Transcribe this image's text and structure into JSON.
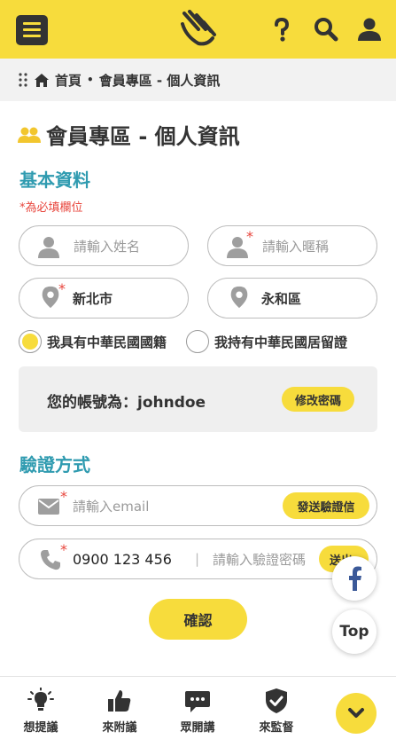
{
  "header": {
    "menu_icon": "hamburger-menu-icon",
    "logo_icon": "hand-logo-icon",
    "help_icon": "question-mark-icon",
    "search_icon": "search-icon",
    "user_icon": "user-icon"
  },
  "breadcrumb": {
    "home": "首頁",
    "separator": "•",
    "current": "會員專區 - 個人資訊"
  },
  "page": {
    "title": "會員專區 - 個人資訊"
  },
  "basic": {
    "title": "基本資料",
    "required_note": "*為必填欄位",
    "name_placeholder": "請輸入姓名",
    "nickname_placeholder": "請輸入暱稱",
    "required_mark": "*",
    "city": "新北市",
    "district": "永和區",
    "radio_citizen": "我具有中華民國國籍",
    "radio_resident": "我持有中華民國居留證",
    "radio_selected": "citizen"
  },
  "account": {
    "label": "您的帳號為：johndoe",
    "change_password": "修改密碼"
  },
  "verify": {
    "title": "驗證方式",
    "email_placeholder": "請輸入email",
    "send_code": "發送驗證信",
    "phone": "0900 123 456",
    "divider": "|",
    "code_placeholder": "請輸入驗證密碼",
    "send_sms": "送出"
  },
  "confirm_label": "確認",
  "floating": {
    "facebook_icon": "facebook-icon",
    "top_label": "Top"
  },
  "bottom_nav": {
    "items": [
      {
        "label": "想提議",
        "icon": "lightbulb-icon"
      },
      {
        "label": "來附議",
        "icon": "thumbs-up-icon"
      },
      {
        "label": "眾開講",
        "icon": "chat-bubble-icon"
      },
      {
        "label": "來監督",
        "icon": "shield-check-icon"
      }
    ],
    "scroll_icon": "chevron-down-icon"
  },
  "colors": {
    "brand_yellow": "#f7dc3c",
    "section_blue": "#2f9bb0",
    "required_red": "#e8453c",
    "facebook_blue": "#3b5998"
  }
}
